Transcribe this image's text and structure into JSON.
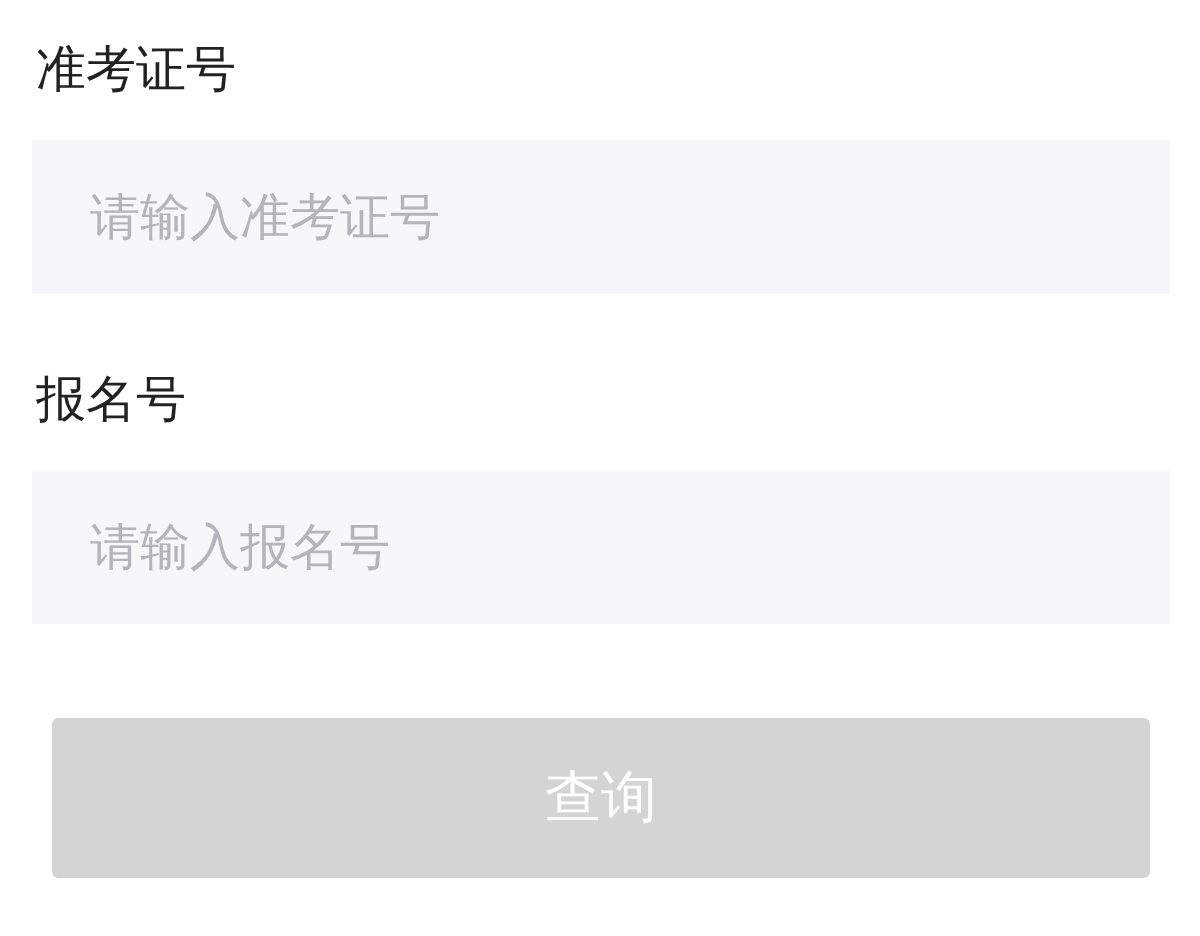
{
  "fields": [
    {
      "label": "准考证号",
      "placeholder": "请输入准考证号"
    },
    {
      "label": "报名号",
      "placeholder": "请输入报名号"
    }
  ],
  "submit_button": {
    "label": "查询",
    "disabled": true
  }
}
